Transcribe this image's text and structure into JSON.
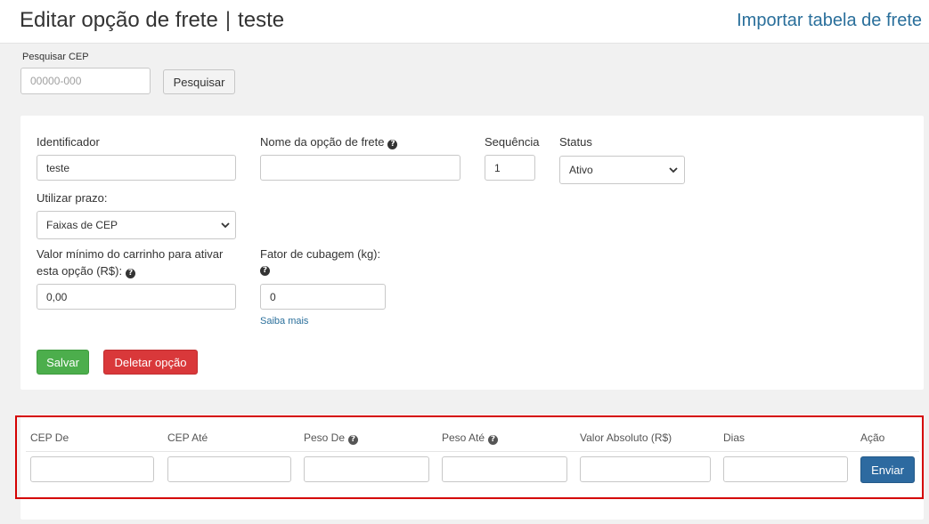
{
  "header": {
    "title": "Editar opção de frete",
    "separator": "|",
    "subtitle": "teste",
    "import_link": "Importar tabela de frete"
  },
  "search": {
    "label": "Pesquisar CEP",
    "placeholder": "00000-000",
    "button": "Pesquisar"
  },
  "form": {
    "identificador": {
      "label": "Identificador",
      "value": "teste"
    },
    "nome": {
      "label": "Nome da opção de frete",
      "value": ""
    },
    "sequencia": {
      "label": "Sequência",
      "value": "1"
    },
    "status": {
      "label": "Status",
      "value": "Ativo"
    },
    "prazo": {
      "label": "Utilizar prazo:",
      "value": "Faixas de CEP"
    },
    "valor_minimo": {
      "label_line1": "Valor mínimo do carrinho para ativar",
      "label_line2": "esta opção (R$):",
      "value": "0,00"
    },
    "cubagem": {
      "label": "Fator de cubagem (kg):",
      "value": "0",
      "link": "Saiba mais"
    },
    "save_button": "Salvar",
    "delete_button": "Deletar opção"
  },
  "ranges": {
    "columns": [
      "CEP De",
      "CEP Até",
      "Peso De",
      "Peso Até",
      "Valor Absoluto (R$)",
      "Dias",
      "Ação"
    ],
    "send_button": "Enviar"
  },
  "icons": {
    "help": "question-circle-icon",
    "dropdown": "chevron-down-icon"
  },
  "colors": {
    "link": "#2a6f9b",
    "save": "#4cae4c",
    "delete": "#d9383a",
    "send": "#2d6aa0",
    "highlight": "#d40000"
  }
}
